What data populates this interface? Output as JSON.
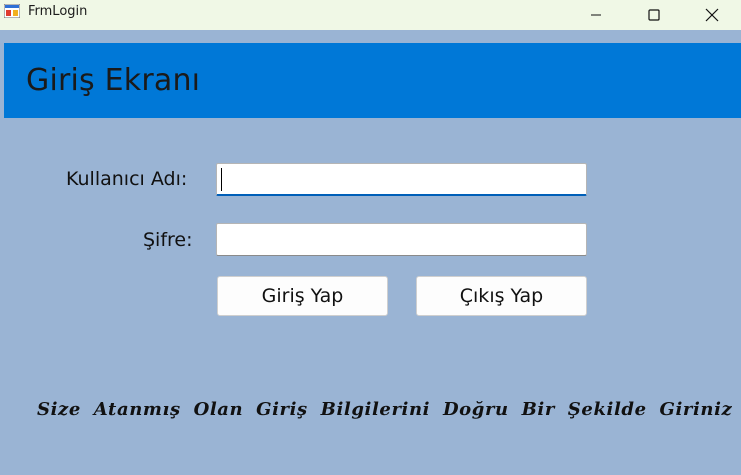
{
  "window": {
    "title": "FrmLogin",
    "icon": "winforms-app-icon",
    "controls": {
      "minimize": "minimize-icon",
      "maximize": "maximize-icon",
      "close": "close-icon"
    }
  },
  "header": {
    "title": "Giriş Ekranı",
    "background": "#0078d7"
  },
  "form": {
    "username_label": "Kullanıcı Adı:",
    "username_value": "",
    "password_label": "Şifre:",
    "password_value": ""
  },
  "buttons": {
    "login_label": "Giriş Yap",
    "exit_label": "Çıkış Yap"
  },
  "info": {
    "message": "Size Atanmış Olan Giriş Bilgilerini Doğru Bir Şekilde Giriniz"
  },
  "colors": {
    "form_background": "#9ab4d4",
    "titlebar_background": "#f0f8e6"
  }
}
